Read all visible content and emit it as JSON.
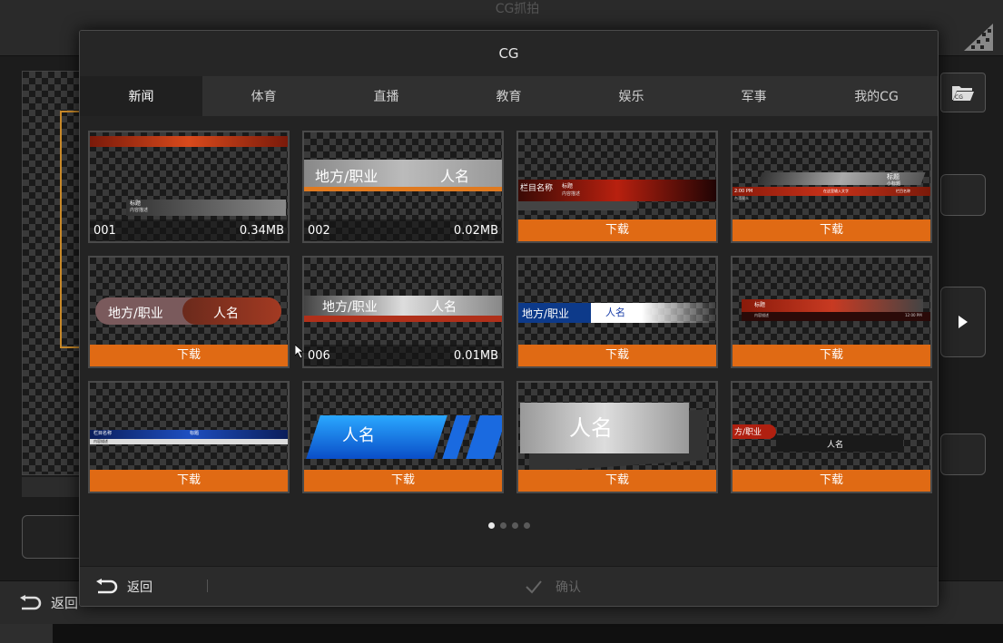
{
  "background": {
    "top_title": "CG抓拍",
    "bottom_back_label": "返回",
    "bottom_center_label": "确认"
  },
  "modal": {
    "title": "CG",
    "tabs": [
      {
        "label": "新闻",
        "active": true
      },
      {
        "label": "体育",
        "active": false
      },
      {
        "label": "直播",
        "active": false
      },
      {
        "label": "教育",
        "active": false
      },
      {
        "label": "娱乐",
        "active": false
      },
      {
        "label": "军事",
        "active": false
      },
      {
        "label": "我的CG",
        "active": false
      }
    ],
    "download_label": "下载",
    "tiles": [
      {
        "id": "001",
        "size": "0.34MB",
        "style": "red-banner",
        "overlay_text": [
          "标题",
          "内容描述"
        ],
        "downloaded": true
      },
      {
        "id": "002",
        "size": "0.02MB",
        "style": "grey-bar",
        "overlay_text": [
          "地方/职业",
          "人名"
        ],
        "downloaded": true
      },
      {
        "style": "red-name",
        "overlay_text": [
          "栏目名称",
          "标题",
          "内容描述"
        ],
        "downloaded": false
      },
      {
        "style": "red-wide",
        "overlay_text": [
          "标题",
          "小标题",
          "2:00 PM",
          "台湾观众",
          "在这里输入文字",
          "栏目名称"
        ],
        "downloaded": false
      },
      {
        "style": "pill",
        "overlay_text": [
          "地方/职业",
          "人名"
        ],
        "downloaded": false
      },
      {
        "id": "006",
        "size": "0.01MB",
        "style": "grey-red",
        "overlay_text": [
          "地方/职业",
          "人名"
        ],
        "downloaded": true
      },
      {
        "style": "blue-white",
        "overlay_text": [
          "地方/职业",
          "人名"
        ],
        "downloaded": false
      },
      {
        "style": "red-top",
        "overlay_text": [
          "标题",
          "内容描述",
          "12:00 PM"
        ],
        "downloaded": false
      },
      {
        "style": "blue-thin",
        "overlay_text": [
          "栏目名称",
          "标题",
          "内容描述"
        ],
        "downloaded": false
      },
      {
        "style": "blue-big",
        "overlay_text": [
          "人名"
        ],
        "downloaded": false
      },
      {
        "style": "grey-big",
        "overlay_text": [
          "人名"
        ],
        "downloaded": false
      },
      {
        "style": "dark-red",
        "overlay_text": [
          "方/职业",
          "人名"
        ],
        "downloaded": false
      }
    ],
    "pagination": {
      "pages": 4,
      "current": 1
    },
    "footer": {
      "back_label": "返回",
      "confirm_label": "确认"
    }
  },
  "colors": {
    "accent": "#e06a14",
    "tab_active_bg": "#202020",
    "modal_bg": "#232323"
  }
}
